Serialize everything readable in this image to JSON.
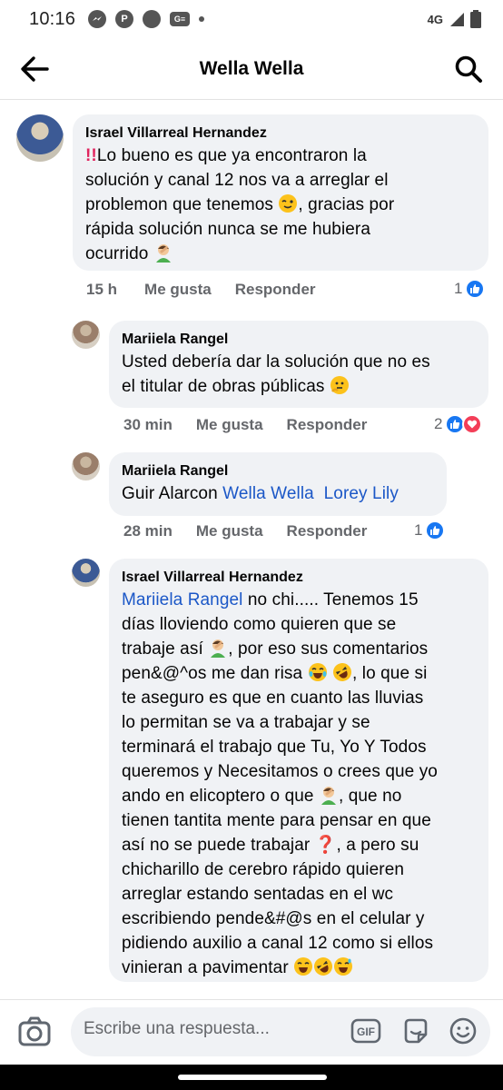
{
  "status": {
    "time": "10:16",
    "network": "4G"
  },
  "header": {
    "title": "Wella Wella"
  },
  "comments": [
    {
      "author": "Israel Villarreal Hernandez",
      "lines": [
        "Lo bueno es que ya encontraron la",
        "solución y canal 12 nos va a arreglar el",
        "problemon que tenemos",
        ", gracias por",
        "rápida solución nunca se me hubiera",
        "ocurrido"
      ],
      "age": "15 h",
      "like_label": "Me gusta",
      "reply_label": "Responder",
      "reactions": "1"
    },
    {
      "author": "Mariiela Rangel",
      "lines": [
        "Usted debería dar la solución que no es",
        "el titular de obras públicas"
      ],
      "age": "30 min",
      "like_label": "Me gusta",
      "reply_label": "Responder",
      "reactions": "2"
    },
    {
      "author": "Mariiela Rangel",
      "plain": "Guir Alarcon ",
      "mentions": [
        "Wella Wella",
        "Lorey Lily"
      ],
      "age": "28 min",
      "like_label": "Me gusta",
      "reply_label": "Responder",
      "reactions": "1"
    },
    {
      "author": "Israel Villarreal Hernandez",
      "mention": "Mariiela Rangel",
      "lines": [
        " no chi..... Tenemos 15",
        "días lloviendo como quieren que se",
        "trabaje así",
        ", por eso sus comentarios",
        "pen&@^os me dan risa",
        ", lo que si",
        "te aseguro es que en cuanto las lluvias",
        "lo permitan se va a trabajar y se",
        "terminará el trabajo que Tu, Yo Y Todos",
        "queremos y Necesitamos o crees que yo",
        "ando en elicoptero o que",
        ", que no",
        "tienen tantita mente para pensar en que",
        "así no se puede trabajar",
        ", a pero su",
        "chicharillo de cerebro rápido quieren",
        "arreglar estando sentadas en el wc",
        "escribiendo pende&#@s en el celular y",
        "pidiendo auxilio a canal 12 como si ellos",
        "vinieran a pavimentar"
      ]
    }
  ],
  "composer": {
    "placeholder": "Escribe una respuesta..."
  }
}
